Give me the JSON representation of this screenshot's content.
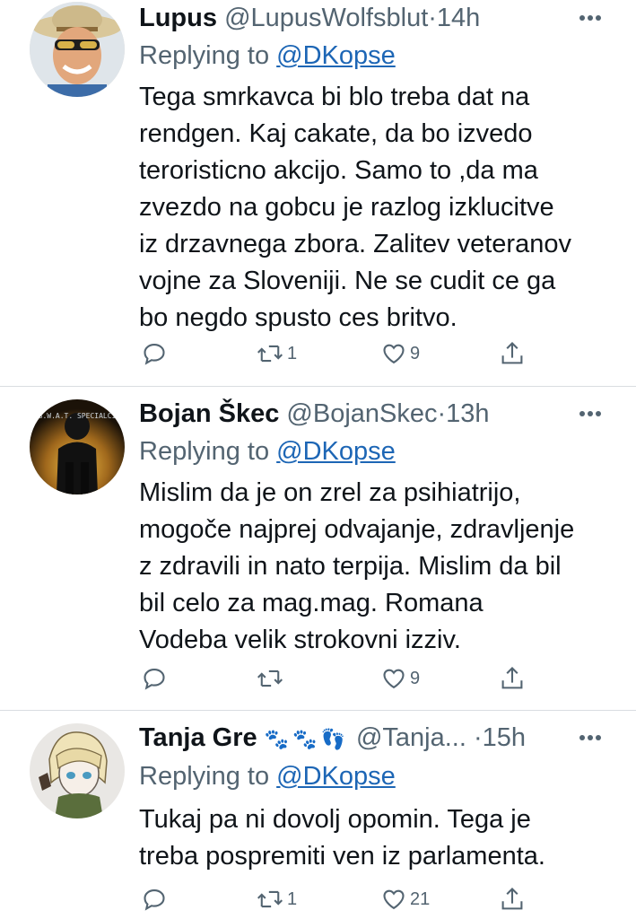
{
  "tweets": [
    {
      "name": "Lupus",
      "emoji": "",
      "handle": "@LupusWolfsblut",
      "time": "14h",
      "reply_prefix": "Replying to",
      "reply_to": "@DKopse",
      "text_lines": [
        "Tega smrkavca bi blo treba dat na",
        "rendgen. Kaj cakate, da bo izvedo",
        "teroristicno akcijo. Samo to ,da ma",
        "zvezdo na gobcu je razlog izklucitve",
        "iz drzavnega zbora. Zalitev veteranov",
        "vojne za Sloveniji. Ne se cudit ce ga",
        "bo negdo spusto ces britvo."
      ],
      "replies": "",
      "retweets": "1",
      "likes": "9"
    },
    {
      "name": "Bojan Škec",
      "emoji": "",
      "handle": "@BojanSkec",
      "time": "13h",
      "reply_prefix": "Replying to",
      "reply_to": "@DKopse",
      "avatar_text": "S.W.A.T. SPECIALCI",
      "text_lines": [
        "Mislim da je on zrel za psihiatrijo,",
        "mogoče najprej odvajanje, zdravljenje",
        "z zdravili in nato terpija. Mislim da bil",
        "bil celo  za mag.mag. Romana",
        "Vodeba velik strokovni izziv."
      ],
      "replies": "",
      "retweets": "",
      "likes": "9"
    },
    {
      "name": "Tanja Gre",
      "emoji": "🐾🐾👣",
      "handle": "@Tanja...",
      "time": "15h",
      "reply_prefix": "Replying to",
      "reply_to": "@DKopse",
      "text_lines": [
        "Tukaj pa ni dovolj opomin. Tega je",
        "treba pospremiti ven iz parlamenta."
      ],
      "replies": "",
      "retweets": "1",
      "likes": "21"
    }
  ],
  "icons": {
    "reply": "reply-icon",
    "retweet": "retweet-icon",
    "like": "heart-icon",
    "share": "share-icon",
    "more": "more-icon"
  },
  "colors": {
    "text": "#0f1419",
    "muted": "#536471",
    "link": "#1d66b5",
    "divider": "#d9dde1"
  }
}
